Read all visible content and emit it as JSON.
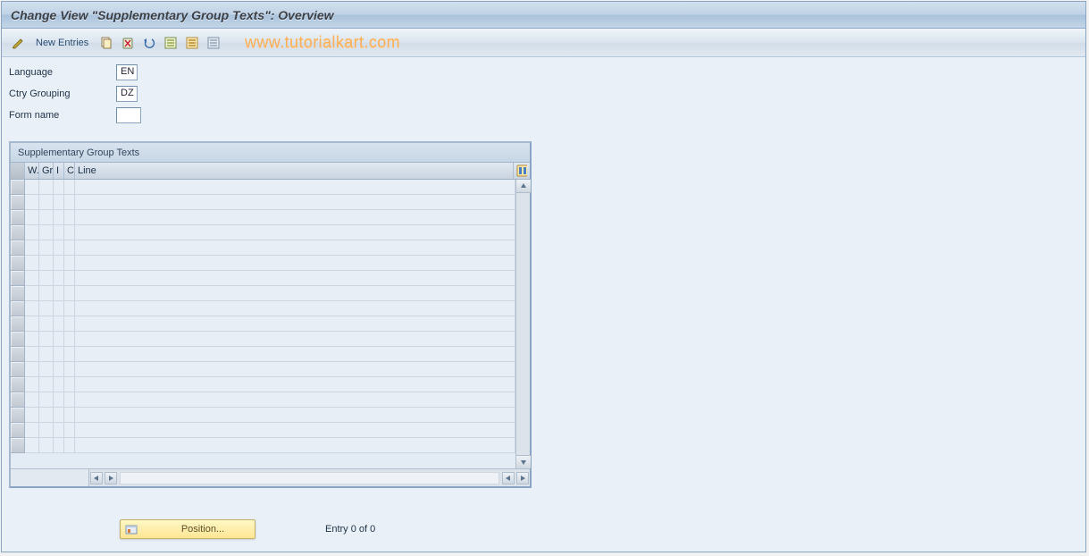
{
  "title": "Change View \"Supplementary Group Texts\": Overview",
  "toolbar": {
    "new_entries": "New Entries"
  },
  "watermark": "www.tutorialkart.com",
  "form": {
    "language_label": "Language",
    "language_value": "EN",
    "ctry_label": "Ctry Grouping",
    "ctry_value": "DZ",
    "formname_label": "Form name",
    "formname_value": ""
  },
  "table": {
    "title": "Supplementary Group Texts",
    "columns": {
      "w": "W.",
      "gr": "Gr",
      "i": "I",
      "c": "C",
      "line": "Line"
    },
    "row_count": 18
  },
  "footer": {
    "position_button": "Position...",
    "entry_text": "Entry 0 of 0"
  }
}
